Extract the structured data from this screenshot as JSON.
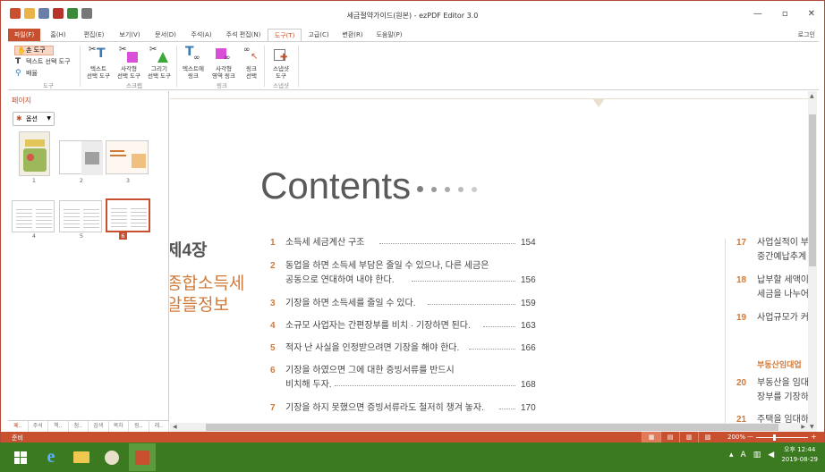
{
  "window": {
    "title": "세금절약가이드(원본) - ezPDF Editor 3.0",
    "controls": {
      "minimize": "—",
      "maximize": "▫",
      "close": "✕"
    }
  },
  "ribbon_tabs": [
    "파일(F)",
    "홈(H)",
    "편집(E)",
    "보기(V)",
    "문서(D)",
    "주석(A)",
    "주석 편집(N)",
    "도구(T)",
    "고급(C)",
    "변환(R)",
    "도움말(P)"
  ],
  "active_tab": "도구(T)",
  "login_label": "로그인",
  "tools_group": {
    "hand_tool": "손 도구",
    "text_select": "텍스트 선택 도구",
    "magnifier": "배율",
    "label": "도구"
  },
  "capture_group": {
    "buttons": [
      "텍스트\n선택 도구",
      "사각형\n선택 도구",
      "그리기\n선택 도구"
    ],
    "label": "스크랩"
  },
  "link_group": {
    "buttons": [
      "텍스트에\n링크",
      "사각형\n영역 링크",
      "링크\n선택"
    ],
    "label": "링크"
  },
  "shape_group": {
    "buttons": [
      "스냅샷\n도구"
    ],
    "label": "스냅샷"
  },
  "left_pane": {
    "title": "페이지",
    "options_button": "옵션",
    "page_numbers": [
      "1",
      "2",
      "3",
      "4",
      "5",
      "6"
    ],
    "bottom_tabs": [
      "페..",
      "주석",
      "책..",
      "첨..",
      "검색",
      "목차",
      "링..",
      "레.."
    ]
  },
  "document": {
    "contents_title": "Contents",
    "chapter": "제4장",
    "chapter_sub_1": "종합소득세",
    "chapter_sub_2": "알뜰정보",
    "toc": [
      {
        "num": "1",
        "lines": [
          "소득세 세금계산 구조"
        ],
        "page": "154"
      },
      {
        "num": "2",
        "lines": [
          "동업을 하면 소득세 부담은 줄일 수 있으나, 다른 세금은",
          "공동으로 연대하여 내야 한다."
        ],
        "page": "156"
      },
      {
        "num": "3",
        "lines": [
          "기장을 하면 소득세를 줄일 수 있다."
        ],
        "page": "159"
      },
      {
        "num": "4",
        "lines": [
          "소규모 사업자는 간편장부를 비치 · 기장하면 된다."
        ],
        "page": "163"
      },
      {
        "num": "5",
        "lines": [
          "적자 난 사실을 인정받으려면 기장을 해야 한다."
        ],
        "page": "166"
      },
      {
        "num": "6",
        "lines": [
          "기장을 하였으면 그에 대한 증빙서류를 반드시",
          "비치해 두자."
        ],
        "page": "168"
      },
      {
        "num": "7",
        "lines": [
          "기장을 하지 못했으면 증빙서류라도 철저히 챙겨 놓자."
        ],
        "page": "170"
      }
    ],
    "toc_right": [
      {
        "num": "17",
        "lines": [
          "사업실적이 부",
          "중간예납추계"
        ]
      },
      {
        "num": "18",
        "lines": [
          "납부할 세액이",
          "세금을 나누어"
        ]
      },
      {
        "num": "19",
        "lines": [
          "사업규모가 커"
        ]
      },
      {
        "num": "20",
        "lines": [
          "부동산을 임대",
          "장부를 기장하"
        ]
      },
      {
        "num": "21",
        "lines": [
          "주택을 임대하"
        ]
      }
    ],
    "right_section_head": "부동산임대업"
  },
  "status": {
    "left": "준비",
    "zoom": "200%",
    "zoom_minus": "—",
    "zoom_plus": "+"
  },
  "taskbar": {
    "time": "오후 12:44",
    "date": "2019-08-29",
    "ime": "A"
  },
  "colors": {
    "accent": "#c8502e",
    "toc_number": "#d07a3a",
    "taskbar": "#3c7a22"
  }
}
